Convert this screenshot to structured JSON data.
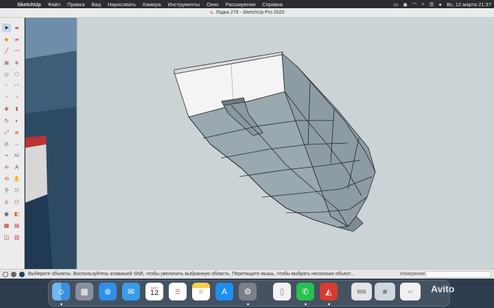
{
  "menubar": {
    "app_name": "SketchUp",
    "items": [
      "Файл",
      "Правка",
      "Вид",
      "Нарисовать",
      "Камера",
      "Инструменты",
      "Окно",
      "Расширения",
      "Справка"
    ],
    "datetime": "Вс, 12 марта  21:37"
  },
  "window": {
    "title": "Лодка 279 - SketchUp Pro 2020"
  },
  "toolbar": {
    "tools": [
      "select-tool-icon",
      "eraser-tool-icon",
      "paint-bucket-icon",
      "erase-icon",
      "line-tool-icon",
      "freehand-tool-icon",
      "rectangle-tool-icon",
      "rotated-rectangle-icon",
      "circle-tool-icon",
      "polygon-tool-icon",
      "arc-tool-icon",
      "two-point-arc-icon",
      "three-point-arc-icon",
      "pie-tool-icon",
      "move-tool-icon",
      "push-pull-icon",
      "rotate-tool-icon",
      "follow-me-icon",
      "scale-tool-icon",
      "offset-tool-icon",
      "tape-measure-icon",
      "dimension-tool-icon",
      "protractor-icon",
      "text-tool-icon",
      "axes-tool-icon",
      "3d-text-icon",
      "orbit-tool-icon",
      "pan-tool-icon",
      "zoom-tool-icon",
      "zoom-extents-icon",
      "position-camera-icon",
      "walk-tool-icon",
      "look-around-icon",
      "section-plane-icon",
      "warehouse-icon",
      "extension-warehouse-icon",
      "layout-icon",
      "extension-manager-icon"
    ]
  },
  "statusbar": {
    "hint": "Выберите объекты. Воспользуйтесь клавишей Shift, чтобы увеличить выбранную область. Перетащите мышь, чтобы выбрать несколько объект...",
    "measure_label": "Измерения",
    "measure_value": ""
  },
  "dock": {
    "calendar_month": "МАРТ",
    "calendar_day": "12",
    "apps": [
      "finder-icon",
      "launchpad-icon",
      "safari-icon",
      "mail-icon",
      "calendar-icon",
      "reminders-icon",
      "notes-icon",
      "app-store-icon",
      "system-preferences-icon",
      "files-icon",
      "whatsapp-icon",
      "sketchup-icon",
      "window-thumbnail-1",
      "window-thumbnail-2",
      "window-thumbnail-3"
    ]
  },
  "watermark": "Avito",
  "colors": {
    "viewport_bg": "#cbd3d6",
    "hull_color": "#8a9aa3",
    "inner_face": "#ffffff"
  }
}
